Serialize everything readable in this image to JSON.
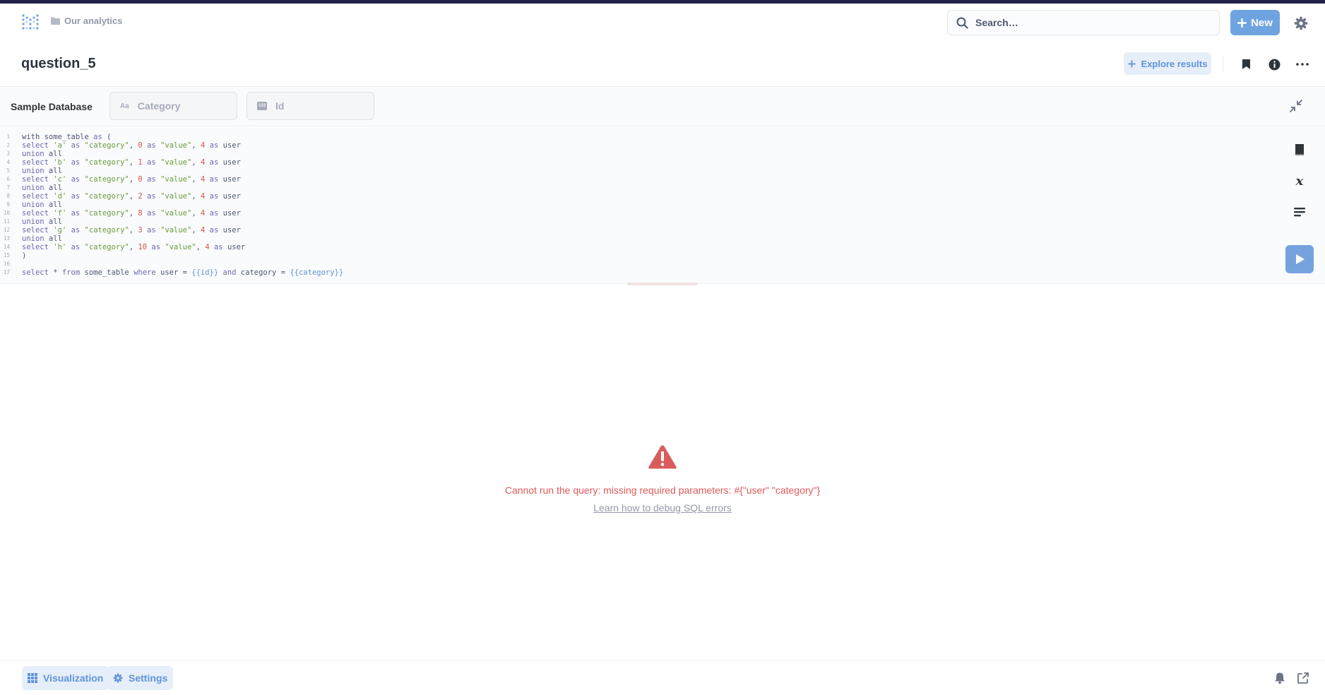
{
  "navbar": {
    "breadcrumb": "Our analytics",
    "search_placeholder": "Search…",
    "new_label": "New"
  },
  "question": {
    "title": "question_5",
    "explore_label": "Explore results"
  },
  "params": {
    "database": "Sample Database",
    "widgets": [
      {
        "icon_text": "Aa",
        "label": "Category"
      },
      {
        "icon_text": "123",
        "label": "Id"
      }
    ]
  },
  "editor": {
    "line_numbers": [
      "1",
      "2",
      "3",
      "4",
      "5",
      "6",
      "7",
      "8",
      "9",
      "10",
      "11",
      "12",
      "13",
      "14",
      "15",
      "16",
      "17"
    ]
  },
  "error": {
    "message": "Cannot run the query: missing required parameters: #{\"user\" \"category\"}",
    "link": "Learn how to debug SQL errors"
  },
  "footer": {
    "visualization_label": "Visualization",
    "settings_label": "Settings"
  },
  "colors": {
    "brand": "#5f94d8",
    "error": "#e0595a",
    "accent_bar": "#232047"
  }
}
